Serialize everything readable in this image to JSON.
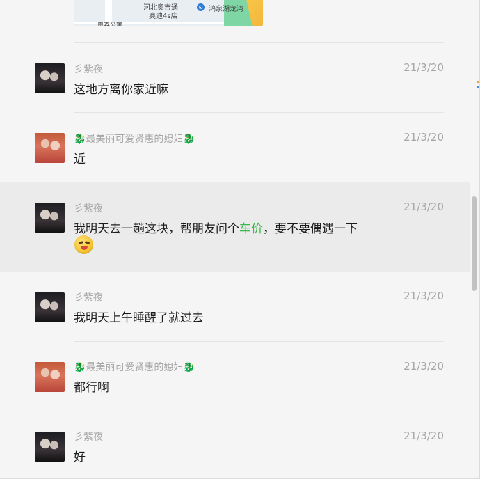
{
  "map": {
    "labels": [
      "河北奥吉通",
      "奥迪4s店",
      "鸿泉湖龙湾",
      "奥森公寓"
    ]
  },
  "messages": [
    {
      "sender": "彡紫夜",
      "time": "21/3/20",
      "text": "这地方离你家近嘛",
      "avatar": "avatar-ziye"
    },
    {
      "sender": "🐉最美丽可爱贤惠的媳妇🐉",
      "time": "21/3/20",
      "text": "近",
      "avatar": "avatar-wife"
    },
    {
      "sender": "彡紫夜",
      "time": "21/3/20",
      "text_before": "我明天去一趟这块，帮朋友问个",
      "link": "车价",
      "text_after": "，要不要偶遇一下",
      "emoji": "wink-emoji",
      "avatar": "avatar-ziye"
    },
    {
      "sender": "彡紫夜",
      "time": "21/3/20",
      "text": "我明天上午睡醒了就过去",
      "avatar": "avatar-ziye"
    },
    {
      "sender": "🐉最美丽可爱贤惠的媳妇🐉",
      "time": "21/3/20",
      "text": "都行啊",
      "avatar": "avatar-wife"
    },
    {
      "sender": "彡紫夜",
      "time": "21/3/20",
      "text": "好",
      "avatar": "avatar-ziye"
    }
  ]
}
